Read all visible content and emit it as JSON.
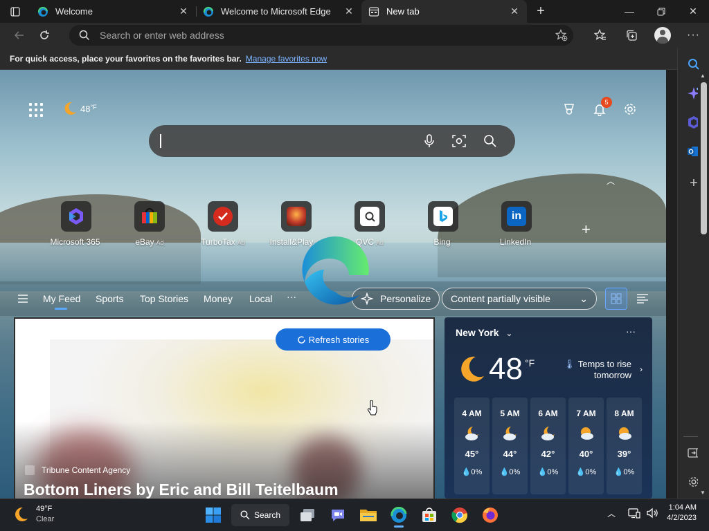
{
  "tabs": [
    {
      "label": "Welcome",
      "active": false
    },
    {
      "label": "Welcome to Microsoft Edge",
      "active": false
    },
    {
      "label": "New tab",
      "active": true
    }
  ],
  "toolbar": {
    "address_placeholder": "Search or enter web address"
  },
  "favorites_bar": {
    "message": "For quick access, place your favorites on the favorites bar.",
    "link": "Manage favorites now"
  },
  "ntp": {
    "weather_temp": "48",
    "weather_unit": "°F",
    "notifications_count": "5",
    "quick_links": [
      {
        "name": "Microsoft 365",
        "ad": ""
      },
      {
        "name": "eBay",
        "ad": "Ad"
      },
      {
        "name": "TurboTax",
        "ad": "Ad"
      },
      {
        "name": "Install&Play",
        "ad": "Ad"
      },
      {
        "name": "QVC",
        "ad": "Ad"
      },
      {
        "name": "Bing",
        "ad": ""
      },
      {
        "name": "LinkedIn",
        "ad": ""
      }
    ],
    "feed_nav": [
      "My Feed",
      "Sports",
      "Top Stories",
      "Money",
      "Local"
    ],
    "more_label": "···",
    "personalize_label": "Personalize",
    "content_visibility_label": "Content partially visible"
  },
  "feed": {
    "refresh_label": "Refresh stories",
    "source": "Tribune Content Agency",
    "headline": "Bottom Liners by Eric and Bill Teitelbaum"
  },
  "weather": {
    "location": "New York",
    "more": "···",
    "temp": "48",
    "unit": "°F",
    "message": "Temps to rise tomorrow",
    "hours": [
      {
        "time": "4 AM",
        "temp": "45°",
        "precip": "0%"
      },
      {
        "time": "5 AM",
        "temp": "44°",
        "precip": "0%"
      },
      {
        "time": "6 AM",
        "temp": "42°",
        "precip": "0%"
      },
      {
        "time": "7 AM",
        "temp": "40°",
        "precip": "0%"
      },
      {
        "time": "8 AM",
        "temp": "39°",
        "precip": "0%"
      }
    ]
  },
  "taskbar": {
    "weather_temp": "49°F",
    "weather_desc": "Clear",
    "search_label": "Search",
    "time": "1:04 AM",
    "date": "4/2/2023"
  },
  "colors": {
    "accent": "#1a6fd8",
    "badge": "#e8481e",
    "link": "#7db4ff"
  }
}
